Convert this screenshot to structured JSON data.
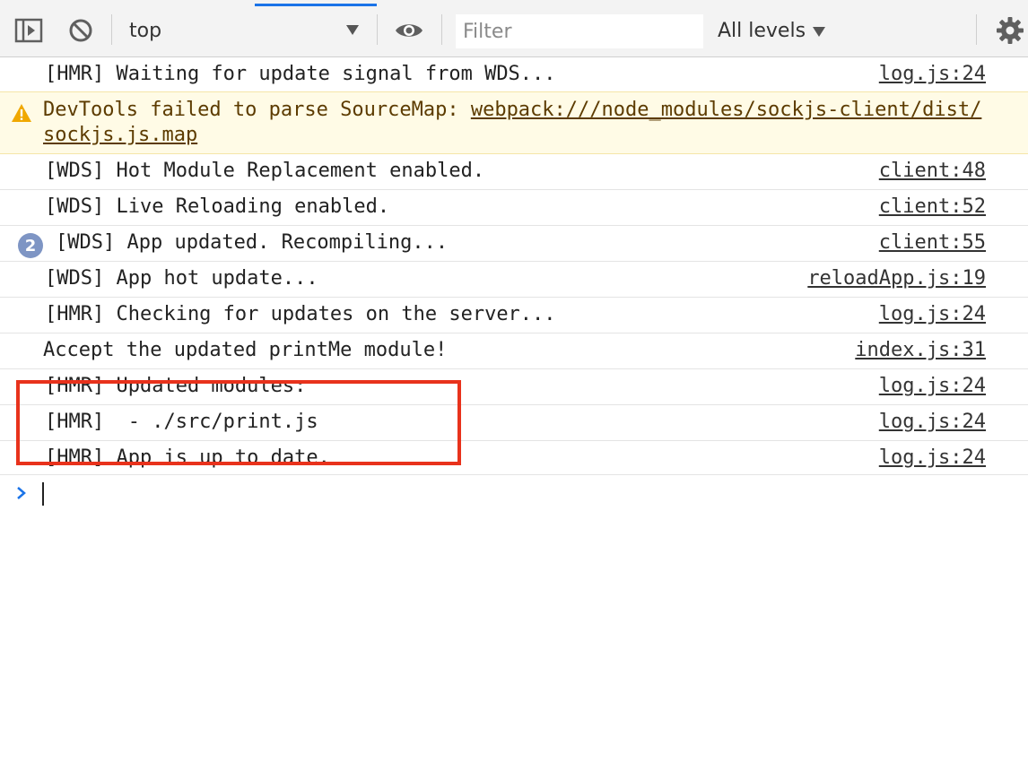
{
  "toolbar": {
    "context": "top",
    "filter_placeholder": "Filter",
    "levels": "All levels"
  },
  "messages": [
    {
      "text": "[HMR] Waiting for update signal from WDS...",
      "source": "log.js:24"
    },
    {
      "text": "DevTools failed to parse SourceMap: ",
      "link": "webpack:///node_modules/sockjs-client/dist/sockjs.js.map",
      "level": "warning"
    },
    {
      "text": "[WDS] Hot Module Replacement enabled.",
      "source": "client:48"
    },
    {
      "text": "[WDS] Live Reloading enabled.",
      "source": "client:52"
    },
    {
      "text": "[WDS] App updated. Recompiling...",
      "source": "client:55",
      "count": "2"
    },
    {
      "text": "[WDS] App hot update...",
      "source": "reloadApp.js:19"
    },
    {
      "text": "[HMR] Checking for updates on the server...",
      "source": "log.js:24"
    },
    {
      "text": "Accept the updated printMe module!",
      "source": "index.js:31"
    },
    {
      "text": "[HMR] Updated modules:",
      "source": "log.js:24"
    },
    {
      "text": "[HMR]  - ./src/print.js",
      "source": "log.js:24"
    },
    {
      "text": "[HMR] App is up to date.",
      "source": "log.js:24"
    }
  ],
  "colors": {
    "highlight": "#e8321c",
    "warning_bg": "#fffbe6",
    "badge": "#7e95c4",
    "prompt": "#1a73e8"
  }
}
